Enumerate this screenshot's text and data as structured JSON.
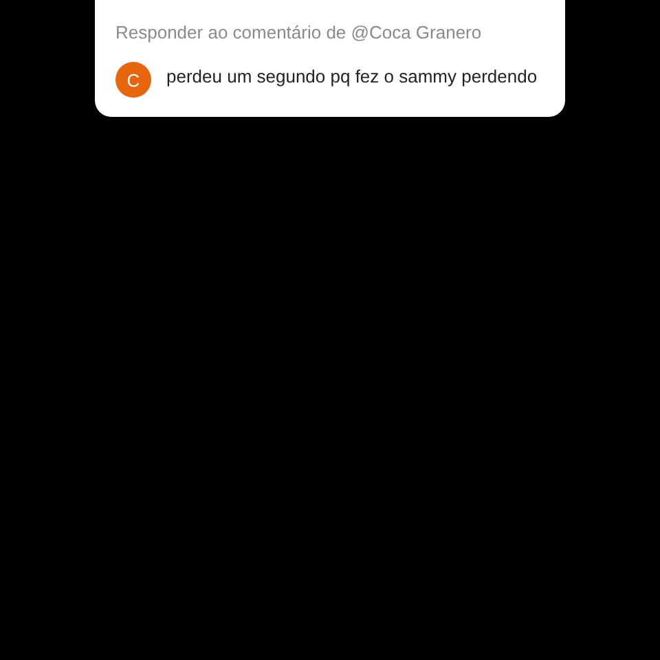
{
  "reply_card": {
    "title": "Responder ao comentário de @Coca Granero",
    "avatar_initial": "C",
    "comment": "perdeu um segundo pq fez o sammy perdendo"
  }
}
